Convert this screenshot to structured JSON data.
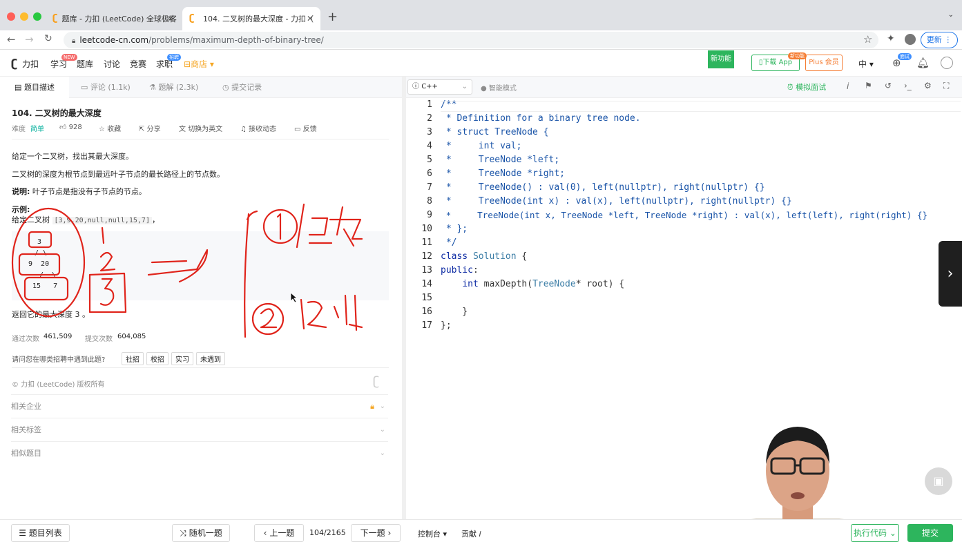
{
  "browser": {
    "tabs": [
      {
        "title": "题库 - 力扣 (LeetCode) 全球极客"
      },
      {
        "title": "104. 二叉树的最大深度 - 力扣（"
      }
    ],
    "new_tab": "+",
    "url_host": "leetcode-cn.com",
    "url_path": "/problems/maximum-depth-of-binary-tree/",
    "update_label": "更新"
  },
  "header": {
    "logo": "力扣",
    "nav": [
      "学习",
      "题库",
      "讨论",
      "竞赛",
      "求职",
      "商店"
    ],
    "learn_badge": "NEW",
    "job_badge": "招聘",
    "new_feature": "新功能",
    "download_app": "下载 App",
    "download_badge": "新功能",
    "plus": "Plus 会员",
    "lang": "中",
    "interview_badge": "面试"
  },
  "left_tabs": [
    "题目描述",
    "评论 (1.1k)",
    "题解 (2.3k)",
    "提交记录"
  ],
  "problem": {
    "title": "104. 二叉树的最大深度",
    "difficulty_label": "难度",
    "difficulty": "简单",
    "likes": "928",
    "actions": [
      "收藏",
      "分享",
      "切换为英文",
      "接收动态",
      "反馈"
    ],
    "desc1": "给定一个二叉树，找出其最大深度。",
    "desc2": "二叉树的深度为根节点到最远叶子节点的最长路径上的节点数。",
    "note_label": "说明:",
    "note": " 叶子节点是指没有子节点的节点。",
    "example_label": "示例:",
    "example_text": "给定二叉树 ",
    "example_code": "[3,9,20,null,null,15,7]",
    "example_tail": "，",
    "tree": [
      "3",
      "/ \\",
      "9  20",
      "/  \\",
      "15   7"
    ],
    "result": "返回它的最大深度 3 。",
    "accepted_label": "通过次数",
    "accepted": "461,509",
    "submitted_label": "提交次数",
    "submitted": "604,085",
    "question": "请问您在哪类招聘中遇到此题?",
    "tags": [
      "社招",
      "校招",
      "实习",
      "未遇到"
    ],
    "copyright": "© 力扣 (LeetCode) 版权所有",
    "sections": [
      "相关企业",
      "相关标签",
      "相似题目"
    ]
  },
  "editor": {
    "language": "C++",
    "mode": "智能模式",
    "mock_interview": "模拟面试",
    "line_numbers": [
      "1",
      "2",
      "3",
      "4",
      "5",
      "6",
      "7",
      "8",
      "9",
      "10",
      "11",
      "12",
      "13",
      "14",
      "15",
      "16",
      "17"
    ]
  },
  "bottom": {
    "list": "题目列表",
    "random": "随机一题",
    "prev": "上一题",
    "page": "104/2165",
    "next": "下一题",
    "console": "控制台",
    "contrib": "贡献",
    "run": "执行代码",
    "submit": "提交"
  },
  "colors": {
    "accent_green": "#2db55d",
    "easy_green": "#00af9b",
    "annotation_red": "#e0241b",
    "plus_orange": "#f57c32"
  }
}
